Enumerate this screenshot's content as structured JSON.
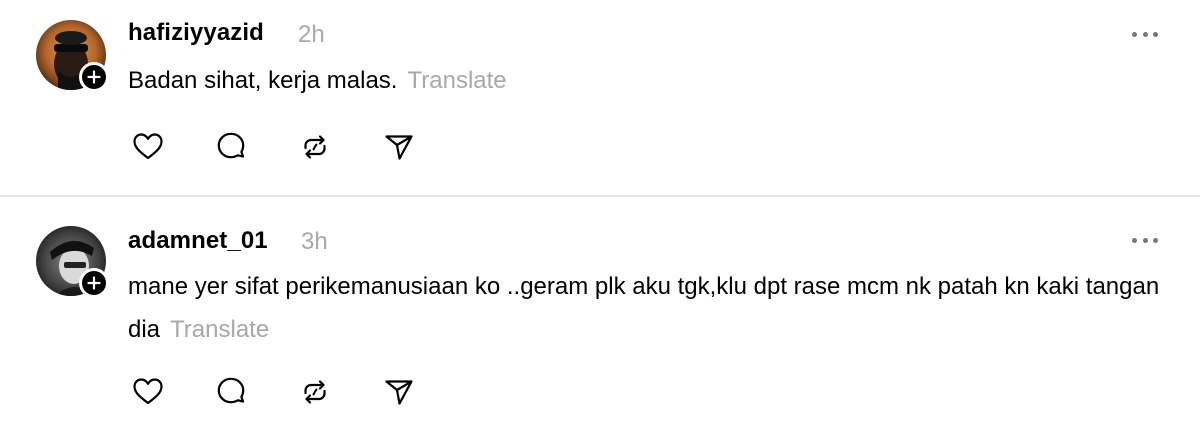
{
  "posts": [
    {
      "username": "hafiziyyazid",
      "time": "2h",
      "text": "Badan sihat, kerja malas.",
      "translate_label": "Translate",
      "avatar_icon": "user-avatar-sunglasses",
      "actions": [
        "heart-icon",
        "comment-icon",
        "repost-icon",
        "share-icon"
      ]
    },
    {
      "username": "adamnet_01",
      "time": "3h",
      "text": "mane yer sifat perikemanusiaan ko ..geram plk aku tgk,klu dpt rase mcm nk patah kn kaki tangan dia",
      "translate_label": "Translate",
      "avatar_icon": "user-avatar-cap",
      "actions": [
        "heart-icon",
        "comment-icon",
        "repost-icon",
        "share-icon"
      ]
    }
  ],
  "colors": {
    "muted": "#a8a8a8",
    "divider": "#e4e4e4",
    "text": "#000000"
  }
}
